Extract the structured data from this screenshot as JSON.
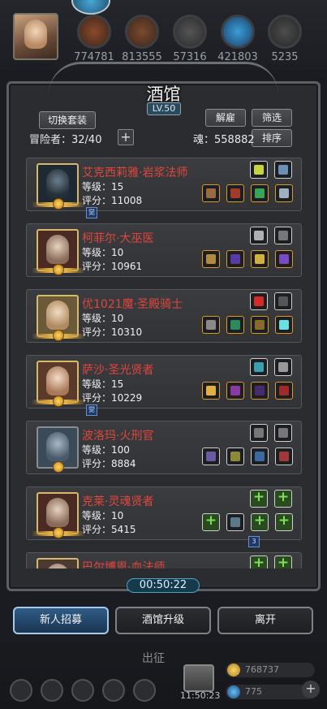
{
  "resources": [
    {
      "icon": "wood-orb",
      "value": "774781"
    },
    {
      "icon": "leather-orb",
      "value": "813555"
    },
    {
      "icon": "iron-orb",
      "value": "57316"
    },
    {
      "icon": "crystal-orb",
      "value": "421803"
    },
    {
      "icon": "stone-orb",
      "value": "5235"
    }
  ],
  "tavern": {
    "title": "酒馆",
    "level": "LV.50",
    "switch_set": "切换套装",
    "dismiss": "解雇",
    "filter": "筛选",
    "sort": "排序",
    "adventurers_label": "冒险者：32/40",
    "soul_label": "魂：558882",
    "plus": "+"
  },
  "heroes": [
    {
      "name": "艾克西莉雅·岩浆法师",
      "level": "等级：15",
      "score": "评分：11008",
      "tag": "觉"
    },
    {
      "name": "柯菲尔·大巫医",
      "level": "等级：10",
      "score": "评分：10961"
    },
    {
      "name": "优1021魔·圣殿骑士",
      "level": "等级：10",
      "score": "评分：10310"
    },
    {
      "name": "萨沙·圣光贤者",
      "level": "等级：15",
      "score": "评分：10229",
      "tag": "觉"
    },
    {
      "name": "波洛玛·火刑官",
      "level": "等级：100",
      "score": "评分：8884"
    },
    {
      "name": "克莱·灵魂贤者",
      "level": "等级：10",
      "score": "评分：5415",
      "tag": "3"
    },
    {
      "name": "巴尔博恩·血法师",
      "level": "",
      "score": ""
    }
  ],
  "timer": "00:50:22",
  "buttons": {
    "recruit": "新人招募",
    "upgrade": "酒馆升级",
    "leave": "离开"
  },
  "footer": {
    "expedition": "出征",
    "time": "11:50:23",
    "gold": "768737",
    "gems": "775",
    "plus": "+"
  }
}
